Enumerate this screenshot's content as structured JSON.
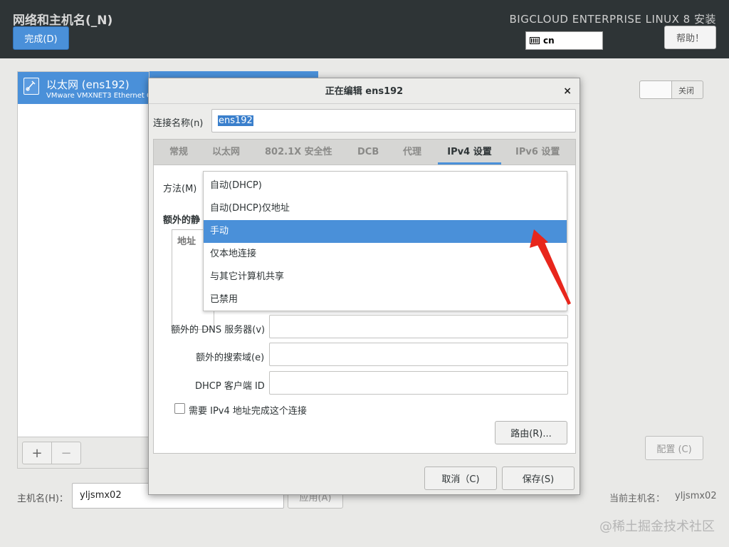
{
  "header": {
    "title": "网络和主机名(_N)",
    "done_label": "完成(D)",
    "product": "BIGCLOUD ENTERPRISE LINUX 8 安装",
    "keyboard_layout": "cn",
    "help_label": "帮助！"
  },
  "interfaces": {
    "items": [
      {
        "name": "以太网 (ens192)",
        "description": "VMware VMXNET3 Ethernet C"
      }
    ],
    "add_label": "+",
    "remove_label": "−"
  },
  "toggle": {
    "label": "关闭",
    "state": "off"
  },
  "config_label": "配置 (C)",
  "hostname": {
    "label": "主机名(H)：",
    "value": "yljsmx02",
    "apply_label": "应用(A)",
    "current_label": "当前主机名：",
    "current_value": "yljsmx02"
  },
  "watermark": "@稀土掘金技术社区",
  "dialog": {
    "title": "正在编辑 ens192",
    "close": "×",
    "connection_name_label": "连接名称(n)",
    "connection_name_value": "ens192",
    "tabs": [
      {
        "label": "常规"
      },
      {
        "label": "以太网"
      },
      {
        "label": "802.1X 安全性"
      },
      {
        "label": "DCB"
      },
      {
        "label": "代理"
      },
      {
        "label": "IPv4 设置"
      },
      {
        "label": "IPv6 设置"
      }
    ],
    "active_tab": "IPv4 设置",
    "method_label": "方法(M)",
    "extra_static_label": "额外的静",
    "address_header": "地址",
    "dns_label": "额外的 DNS 服务器(v)",
    "search_domain_label": "额外的搜索域(e)",
    "dhcp_client_id_label": "DHCP 客户端 ID",
    "require_ipv4_label": "需要 IPv4 地址完成这个连接",
    "require_ipv4_checked": false,
    "routes_label": "路由(R)...",
    "cancel_label": "取消（C)",
    "save_label": "保存(S)"
  },
  "method_options": [
    {
      "label": "自动(DHCP)"
    },
    {
      "label": "自动(DHCP)仅地址"
    },
    {
      "label": "手动"
    },
    {
      "label": "仅本地连接"
    },
    {
      "label": "与其它计算机共享"
    },
    {
      "label": "已禁用"
    }
  ],
  "method_selected": "手动",
  "colors": {
    "accent": "#4a90d9",
    "topbar": "#2e3436",
    "annotation_arrow": "#e8261c"
  }
}
